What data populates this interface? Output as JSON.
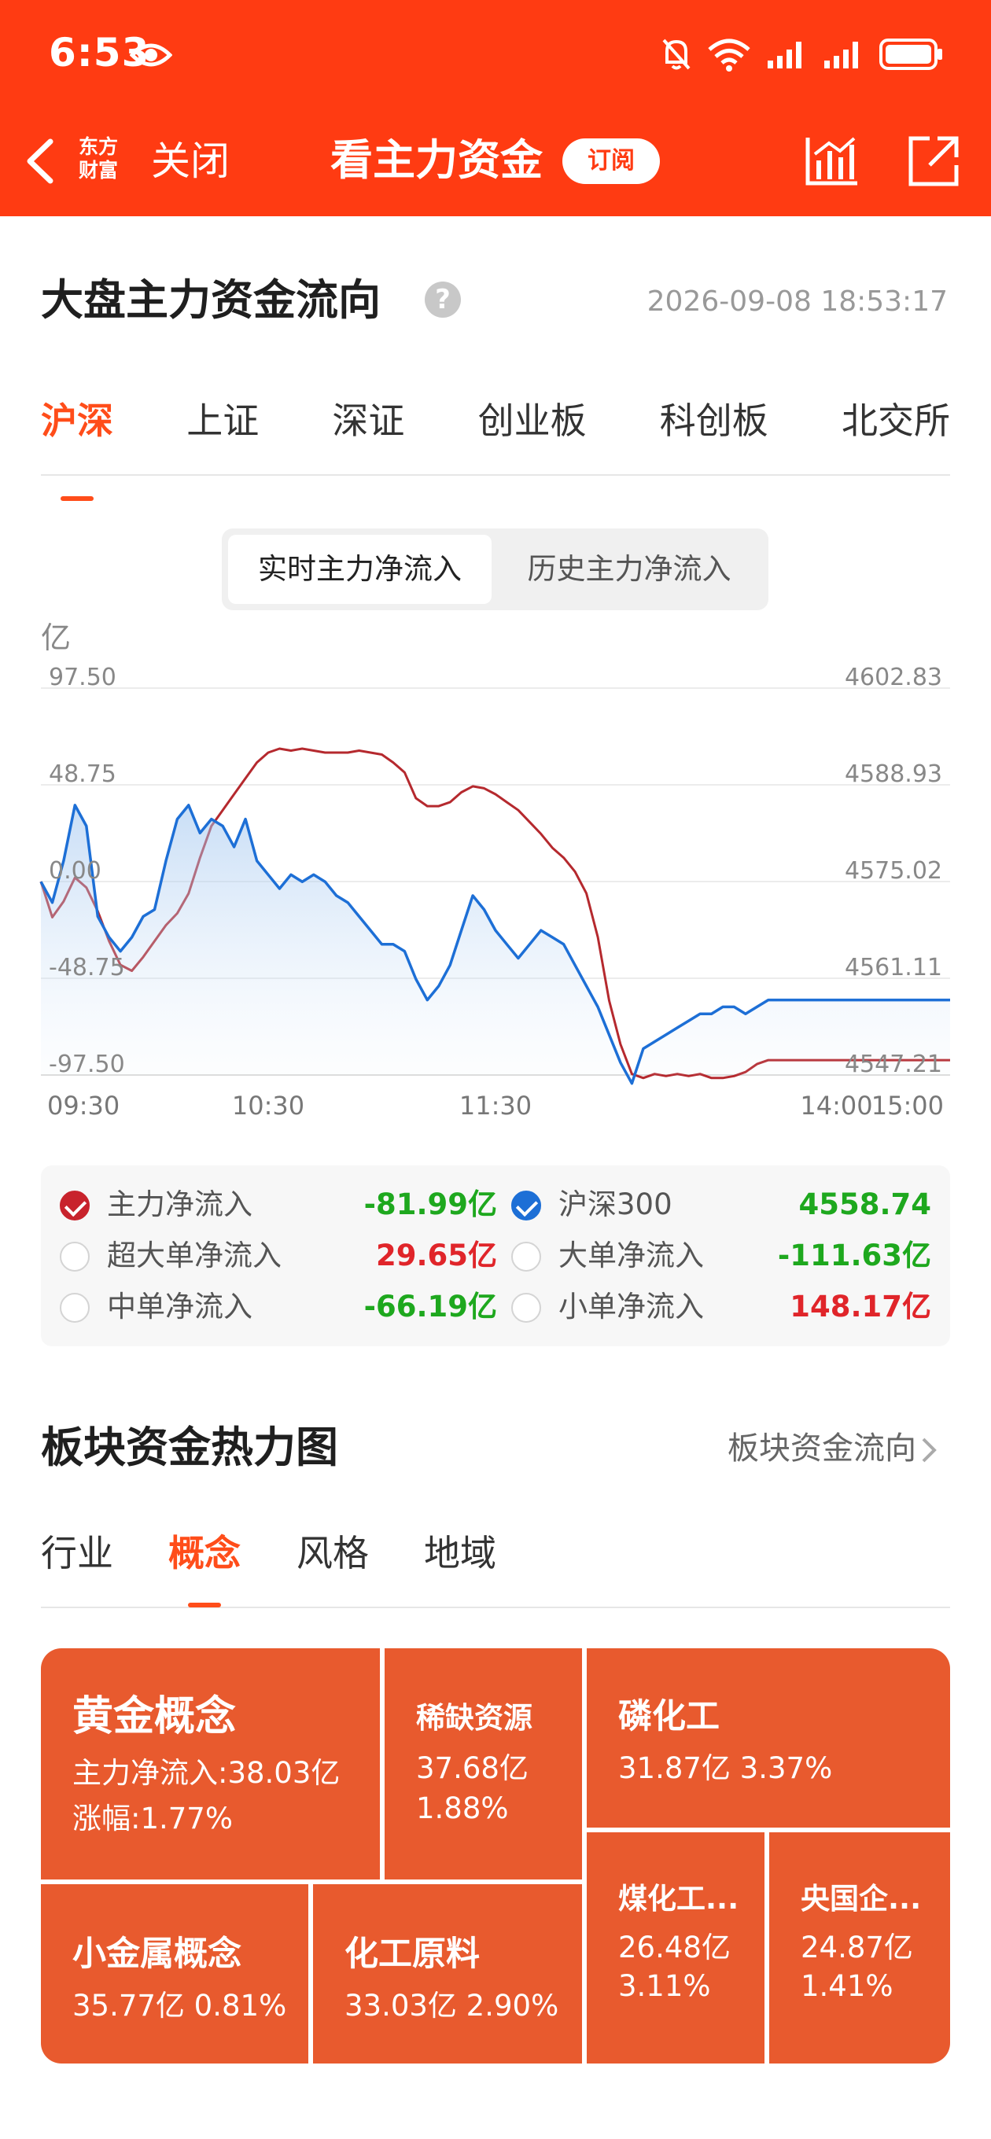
{
  "status": {
    "time": "6:53"
  },
  "nav": {
    "logo_line1": "东方",
    "logo_line2": "财富",
    "close": "关闭",
    "title": "看主力资金",
    "subscribe": "订阅"
  },
  "section": {
    "title": "大盘主力资金流向",
    "help": "?",
    "timestamp": "2026-09-08 18:53:17"
  },
  "tabs": [
    "沪深",
    "上证",
    "深证",
    "创业板",
    "科创板",
    "北交所"
  ],
  "toggle": {
    "on": "实时主力净流入",
    "off": "历史主力净流入"
  },
  "colors": {
    "accent": "#ff3b12",
    "positive": "#e0252a",
    "negative": "#1ea81e",
    "index_line": "#1d6fd6",
    "flow_line": "#b5292e"
  },
  "chart_data": {
    "type": "line",
    "unit": "亿",
    "x_ticks": [
      "09:30",
      "10:30",
      "11:30",
      "14:00",
      "15:00"
    ],
    "y_left_ticks": [
      "97.50",
      "48.75",
      "0.00",
      "-48.75",
      "-97.50"
    ],
    "y_left_range": [
      -97.5,
      97.5
    ],
    "y_right_ticks": [
      "4602.83",
      "4588.93",
      "4575.02",
      "4561.11",
      "4547.21"
    ],
    "y_right_range": [
      4547.21,
      4602.83
    ],
    "grid": true,
    "series": [
      {
        "name": "主力净流入",
        "axis": "left",
        "color": "#b5292e",
        "x": [
          0,
          3,
          6,
          9,
          12,
          15,
          18,
          21,
          24,
          27,
          30,
          33,
          36,
          39,
          42,
          45,
          48,
          51,
          54,
          57,
          60,
          63,
          66,
          69,
          72,
          75,
          78,
          81,
          84,
          87,
          90,
          93,
          96,
          99,
          102,
          105,
          108,
          111,
          114,
          117,
          120,
          123,
          126,
          129,
          132,
          135,
          138,
          141,
          144,
          147,
          150,
          153,
          156,
          159,
          162,
          165,
          168,
          171,
          174,
          177,
          180,
          183,
          186,
          189,
          192,
          195,
          198,
          201,
          204,
          207,
          210,
          213,
          216,
          219,
          222,
          225,
          228,
          231,
          234,
          237,
          240
        ],
        "values": [
          0,
          -18,
          -10,
          2,
          -3,
          -15,
          -30,
          -42,
          -45,
          -38,
          -30,
          -22,
          -16,
          -6,
          12,
          28,
          36,
          44,
          52,
          60,
          65,
          67,
          66,
          67,
          66,
          65,
          65,
          65,
          66,
          65,
          64,
          60,
          55,
          42,
          38,
          38,
          40,
          45,
          48,
          47,
          44,
          40,
          36,
          30,
          24,
          17,
          12,
          5,
          -6,
          -28,
          -60,
          -82,
          -97,
          -99,
          -97,
          -98,
          -97,
          -98,
          -97,
          -99,
          -99,
          -98,
          -96,
          -92,
          -90,
          -90,
          -90,
          -90,
          -90,
          -90,
          -90,
          -90,
          -90,
          -90,
          -90,
          -90,
          -90,
          -90,
          -90,
          -90,
          -90
        ]
      },
      {
        "name": "沪深300",
        "axis": "right",
        "color": "#1d6fd6",
        "x": [
          0,
          3,
          6,
          9,
          12,
          15,
          18,
          21,
          24,
          27,
          30,
          33,
          36,
          39,
          42,
          45,
          48,
          51,
          54,
          57,
          60,
          63,
          66,
          69,
          72,
          75,
          78,
          81,
          84,
          87,
          90,
          93,
          96,
          99,
          102,
          105,
          108,
          111,
          114,
          117,
          120,
          123,
          126,
          129,
          132,
          135,
          138,
          141,
          144,
          147,
          150,
          153,
          156,
          159,
          162,
          165,
          168,
          171,
          174,
          177,
          180,
          183,
          186,
          189,
          192,
          195,
          198,
          201,
          204,
          207,
          210,
          213,
          216,
          219,
          222,
          225,
          228,
          231,
          234,
          237,
          240
        ],
        "values": [
          4575,
          4572,
          4578,
          4586,
          4583,
          4570,
          4567,
          4565,
          4567,
          4570,
          4571,
          4578,
          4584,
          4586,
          4582,
          4584,
          4583,
          4580,
          4584,
          4578,
          4576,
          4574,
          4576,
          4575,
          4576,
          4575,
          4573,
          4572,
          4570,
          4568,
          4566,
          4566,
          4565,
          4561,
          4558,
          4560,
          4563,
          4568,
          4573,
          4571,
          4568,
          4566,
          4564,
          4566,
          4568,
          4567,
          4566,
          4563,
          4560,
          4557,
          4553,
          4549,
          4546,
          4551,
          4552,
          4553,
          4554,
          4555,
          4556,
          4556,
          4557,
          4557,
          4556,
          4557,
          4558,
          4558,
          4558,
          4558,
          4558,
          4558,
          4558,
          4558,
          4558,
          4558,
          4558,
          4558,
          4558,
          4558,
          4558,
          4558,
          4558
        ]
      }
    ]
  },
  "legend": [
    {
      "name": "主力净流入",
      "value": "-81.99亿",
      "checked": "red",
      "sign": "neg"
    },
    {
      "name": "沪深300",
      "value": "4558.74",
      "checked": "blue",
      "sign": "neg"
    },
    {
      "name": "超大单净流入",
      "value": "29.65亿",
      "checked": "none",
      "sign": "pos"
    },
    {
      "name": "大单净流入",
      "value": "-111.63亿",
      "checked": "none",
      "sign": "neg"
    },
    {
      "name": "中单净流入",
      "value": "-66.19亿",
      "checked": "none",
      "sign": "neg"
    },
    {
      "name": "小单净流入",
      "value": "148.17亿",
      "checked": "none",
      "sign": "pos"
    }
  ],
  "heatmap": {
    "title": "板块资金热力图",
    "link": "板块资金流向",
    "tabs": [
      "行业",
      "概念",
      "风格",
      "地域"
    ],
    "cells": [
      {
        "name": "黄金概念",
        "line1": "主力净流入:38.03亿",
        "line2": "涨幅:1.77%"
      },
      {
        "name": "稀缺资源",
        "line1": "37.68亿",
        "line2": "1.88%"
      },
      {
        "name": "磷化工",
        "line1": "31.87亿  3.37%"
      },
      {
        "name": "小金属概念",
        "line1": "35.77亿  0.81%"
      },
      {
        "name": "化工原料",
        "line1": "33.03亿  2.90%"
      },
      {
        "name": "煤化工...",
        "line1": "26.48亿",
        "line2": "3.11%"
      },
      {
        "name": "央国企...",
        "line1": "24.87亿",
        "line2": "1.41%"
      }
    ]
  }
}
